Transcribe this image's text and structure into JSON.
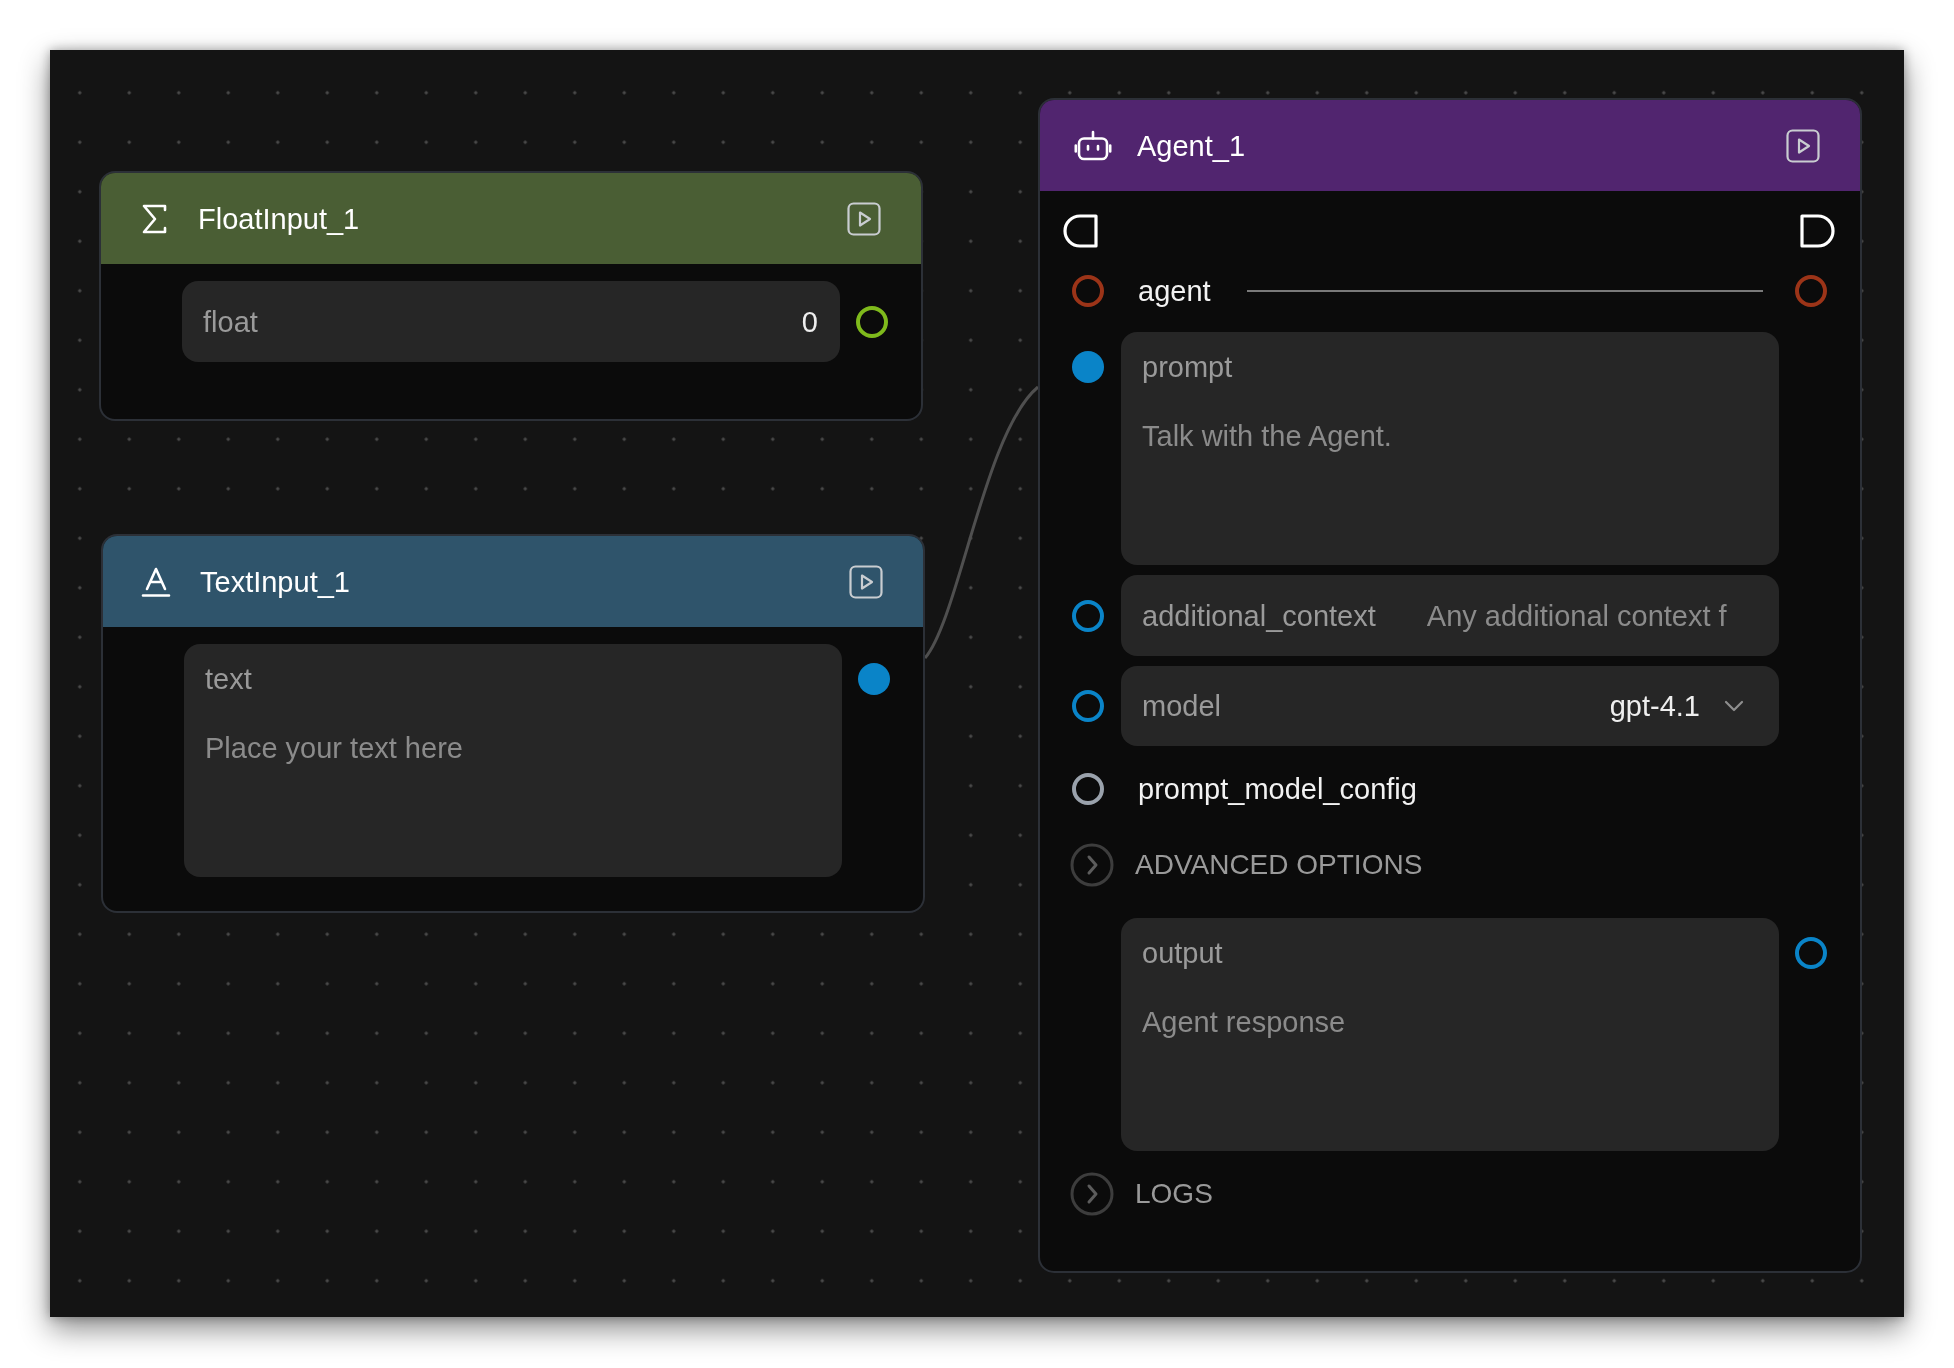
{
  "canvas": {
    "nodes": [
      {
        "kind": "float_input",
        "title": "FloatInput_1",
        "color": "#4a5e34",
        "rows": [
          {
            "kind": "number",
            "label": "float",
            "value": "0",
            "output_port": {
              "color": "#7fba1c",
              "connected": false
            }
          }
        ]
      },
      {
        "kind": "text_input",
        "title": "TextInput_1",
        "color": "#2f546b",
        "rows": [
          {
            "kind": "textarea",
            "label": "text",
            "placeholder": "Place your text here",
            "output_port": {
              "color": "#0a84c8",
              "connected": true
            }
          }
        ]
      },
      {
        "kind": "agent",
        "title": "Agent_1",
        "color": "#51256f",
        "rows": [
          {
            "kind": "triggers"
          },
          {
            "kind": "link",
            "label": "agent",
            "input_port": {
              "color": "#9c3418",
              "connected": false
            },
            "output_port": {
              "color": "#9c3418",
              "connected": false
            }
          },
          {
            "kind": "textarea",
            "label": "prompt",
            "placeholder": "Talk with the Agent.",
            "input_port": {
              "color": "#0a84c8",
              "connected": true
            }
          },
          {
            "kind": "text",
            "label": "additional_context",
            "placeholder": "Any additional context f",
            "input_port": {
              "color": "#0a84c8",
              "connected": false
            }
          },
          {
            "kind": "select",
            "label": "model",
            "value": "gpt-4.1",
            "input_port": {
              "color": "#0a84c8",
              "connected": false
            }
          },
          {
            "kind": "plain",
            "label": "prompt_model_config",
            "input_port": {
              "color": "#9aa2ac",
              "connected": false
            }
          },
          {
            "kind": "section",
            "label": "ADVANCED OPTIONS",
            "expanded": false
          },
          {
            "kind": "textarea",
            "label": "output",
            "placeholder": "Agent response",
            "output_port": {
              "color": "#0a84c8",
              "connected": false
            }
          },
          {
            "kind": "section",
            "label": "LOGS",
            "expanded": false
          }
        ]
      }
    ]
  }
}
